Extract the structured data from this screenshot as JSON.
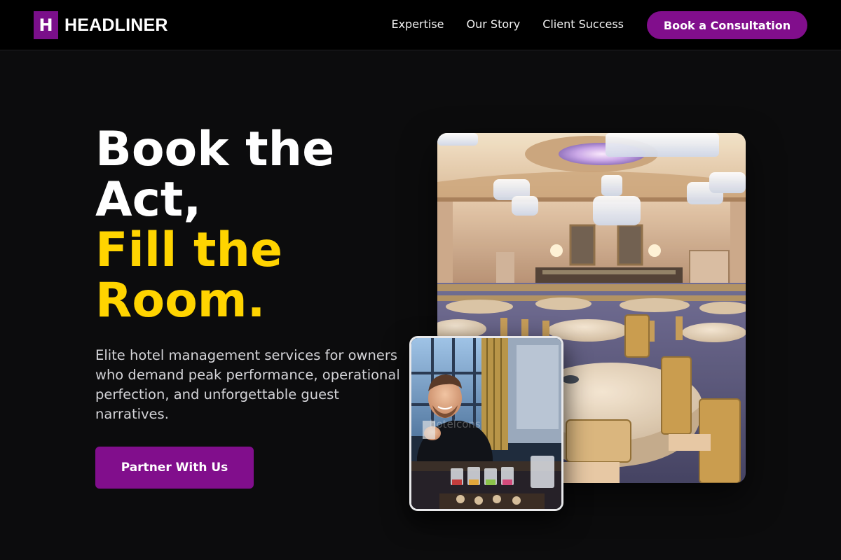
{
  "header": {
    "logo_mark": "H",
    "logo_text": "HEADLINER",
    "nav": [
      {
        "label": "Expertise"
      },
      {
        "label": "Our Story"
      },
      {
        "label": "Client Success"
      }
    ],
    "cta_label": "Book a Consultation"
  },
  "hero": {
    "title_line_1": "Book the",
    "title_line_2": "Act,",
    "title_line_3": "Fill the",
    "title_line_4": "Room.",
    "description": "Elite hotel management services for owners who demand peak performance, operational perfection, and unforgettable guest narratives.",
    "cta_label": "Partner With Us"
  },
  "images": {
    "ballroom_watermark": "",
    "bartender_watermark": "hotelcons"
  },
  "colors": {
    "background": "#0c0c0d",
    "header_bg": "#000000",
    "brand_purple": "#810e8c",
    "accent_yellow": "#ffd400",
    "text_muted": "#d4d4d8"
  }
}
